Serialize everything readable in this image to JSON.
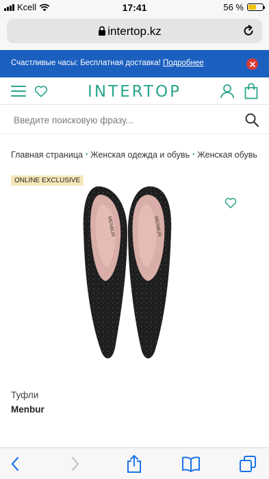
{
  "status_bar": {
    "carrier": "Kcell",
    "time": "17:41",
    "battery": "56 %",
    "battery_level": 0.56
  },
  "browser": {
    "url": "intertop.kz"
  },
  "promo": {
    "text": "Счастливые часы: Бесплатная доставка! ",
    "link": "Подробнее",
    "accent": "#1b5fbf"
  },
  "header": {
    "logo": "INTERTOP",
    "brand_color": "#2aa58b"
  },
  "search": {
    "placeholder": "Введите поисковую фразу..."
  },
  "breadcrumb": [
    "Главная страница",
    "Женская одежда и обувь",
    "Женская обувь"
  ],
  "product": {
    "badge": "ONLINE EXCLUSIVE",
    "type": "Туфли",
    "brand": "Menbur",
    "insole_text": "MENBUR"
  },
  "toolbar": {
    "icons": [
      "back-icon",
      "forward-icon",
      "share-icon",
      "bookmarks-icon",
      "tabs-icon"
    ]
  }
}
